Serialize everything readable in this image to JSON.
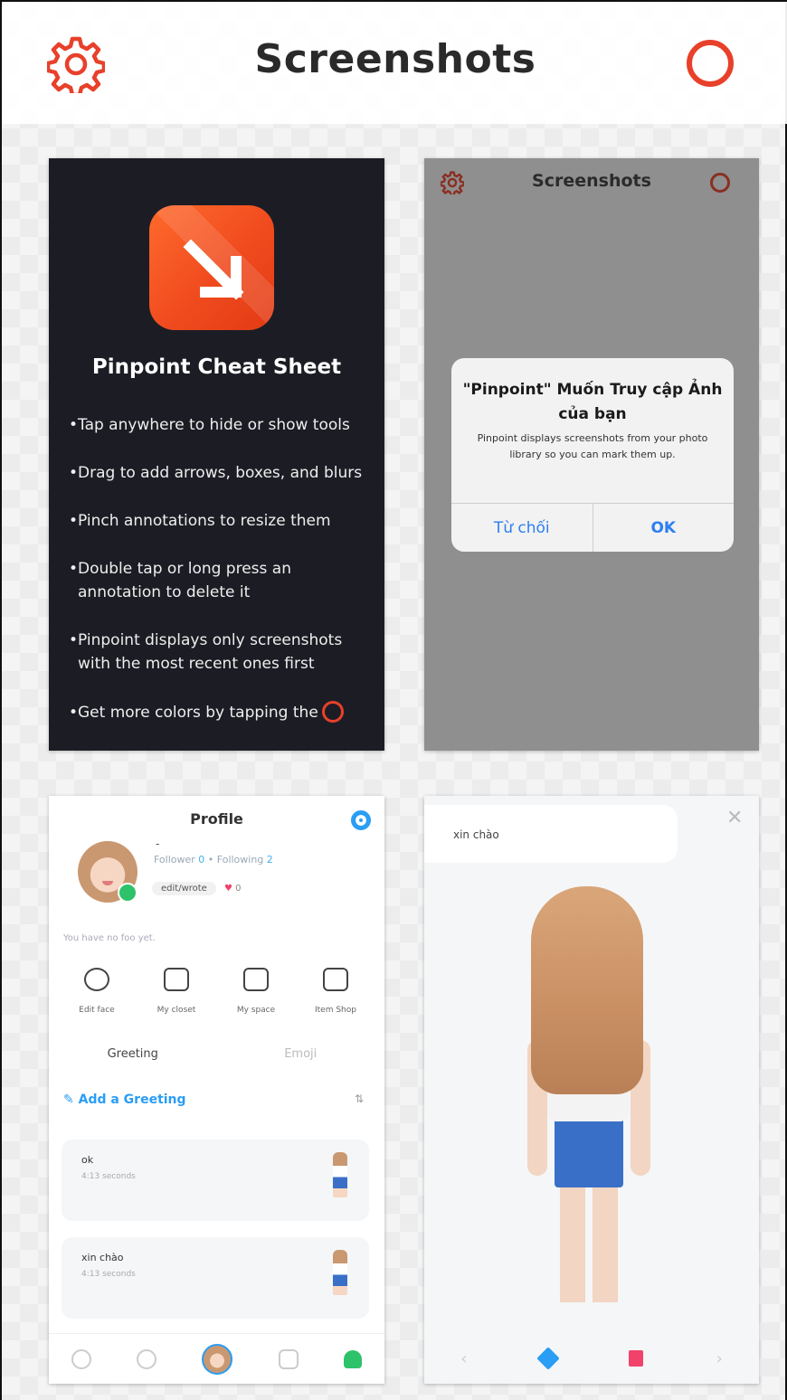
{
  "header": {
    "title": "Screenshots",
    "settings_icon": "gear-icon",
    "color_picker_icon": "ring-icon",
    "accent_color": "#e8402a"
  },
  "cheat_sheet": {
    "heading": "Pinpoint Cheat Sheet",
    "tips": [
      "Tap anywhere to hide or show tools",
      "Drag to add arrows, boxes, and blurs",
      "Pinch annotations to resize them",
      "Double tap or long press an annotation to delete it",
      "Pinpoint displays only screenshots with the most recent ones first",
      "Get more colors by tapping the"
    ]
  },
  "permission_shot": {
    "title": "Screenshots",
    "dialog_title": "\"Pinpoint\" Muốn Truy cập Ảnh của bạn",
    "dialog_message": "Pinpoint displays screenshots from your photo library so you can mark them up.",
    "deny_label": "Từ chối",
    "ok_label": "OK"
  },
  "profile_shot": {
    "title": "Profile",
    "name": "-",
    "follower_label": "Follower",
    "follower_count": "0",
    "following_label": "Following",
    "following_count": "2",
    "chip": "edit/wrote",
    "likes": "0",
    "no_gift": "You have no foo yet.",
    "quick_actions": [
      "Edit face",
      "My closet",
      "My space",
      "Item Shop"
    ],
    "tabs": [
      "Greeting",
      "Emoji"
    ],
    "add_greeting": "Add a Greeting",
    "greetings": [
      {
        "text": "ok",
        "time": "4:13 seconds"
      },
      {
        "text": "xin chào",
        "time": "4:13 seconds"
      }
    ]
  },
  "avatar_shot": {
    "bubble_text": "xin chào",
    "close_icon": "close-icon"
  }
}
